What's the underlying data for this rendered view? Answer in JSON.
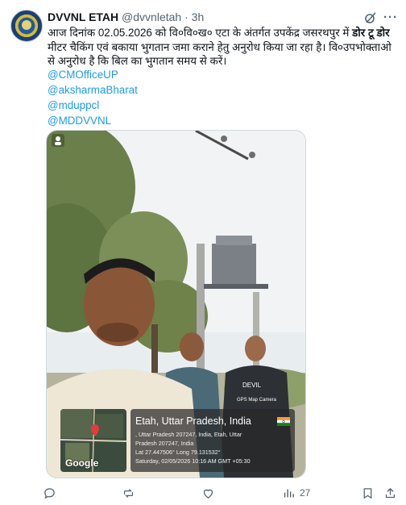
{
  "tweet": {
    "author_name": "DVVNL ETAH",
    "handle": "@dvvnletah",
    "separator": "·",
    "time": "3h",
    "text_part1": "आज दिनांक 02.05.2026 को वि०वि०ख० एटा के अंतर्गत उपकेंद्र जसरथपुर  में ",
    "text_bold": "डोर टू डोर",
    "text_part2": " मीटर चैकिंग एवं बकाया भुगतान जमा कराने हेतु अनुरोध किया जा रहा है। वि०उपभोक्ताओ से अनुरोध है कि बिल का भुगतान समय से करें।",
    "mentions": [
      "@CMOfficeUP",
      "@aksharmaBharat",
      "@mduppcl",
      "@MDDVVNL"
    ]
  },
  "photo": {
    "location_title": "Etah, Uttar Pradesh, India",
    "address_line1": ", Uttar Pradesh 207247, India, Etah, Uttar",
    "address_line2": "Pradesh 207247, India",
    "coords": "Lat 27.447506° Long 79.131532°",
    "datetime": "Saturday, 02/05/2026 10:16 AM GMT +05:30",
    "map_brand": "Google",
    "camera_app": "GPS Map Camera",
    "tshirt_text": "DEVIL"
  },
  "actions": {
    "reply_icon": "reply-icon",
    "repost_icon": "repost-icon",
    "like_icon": "like-icon",
    "views_count": "27",
    "bookmark_icon": "bookmark-icon",
    "share_icon": "share-icon"
  },
  "colors": {
    "link": "#1d9bf0",
    "muted": "#536471",
    "text": "#0f1419"
  }
}
